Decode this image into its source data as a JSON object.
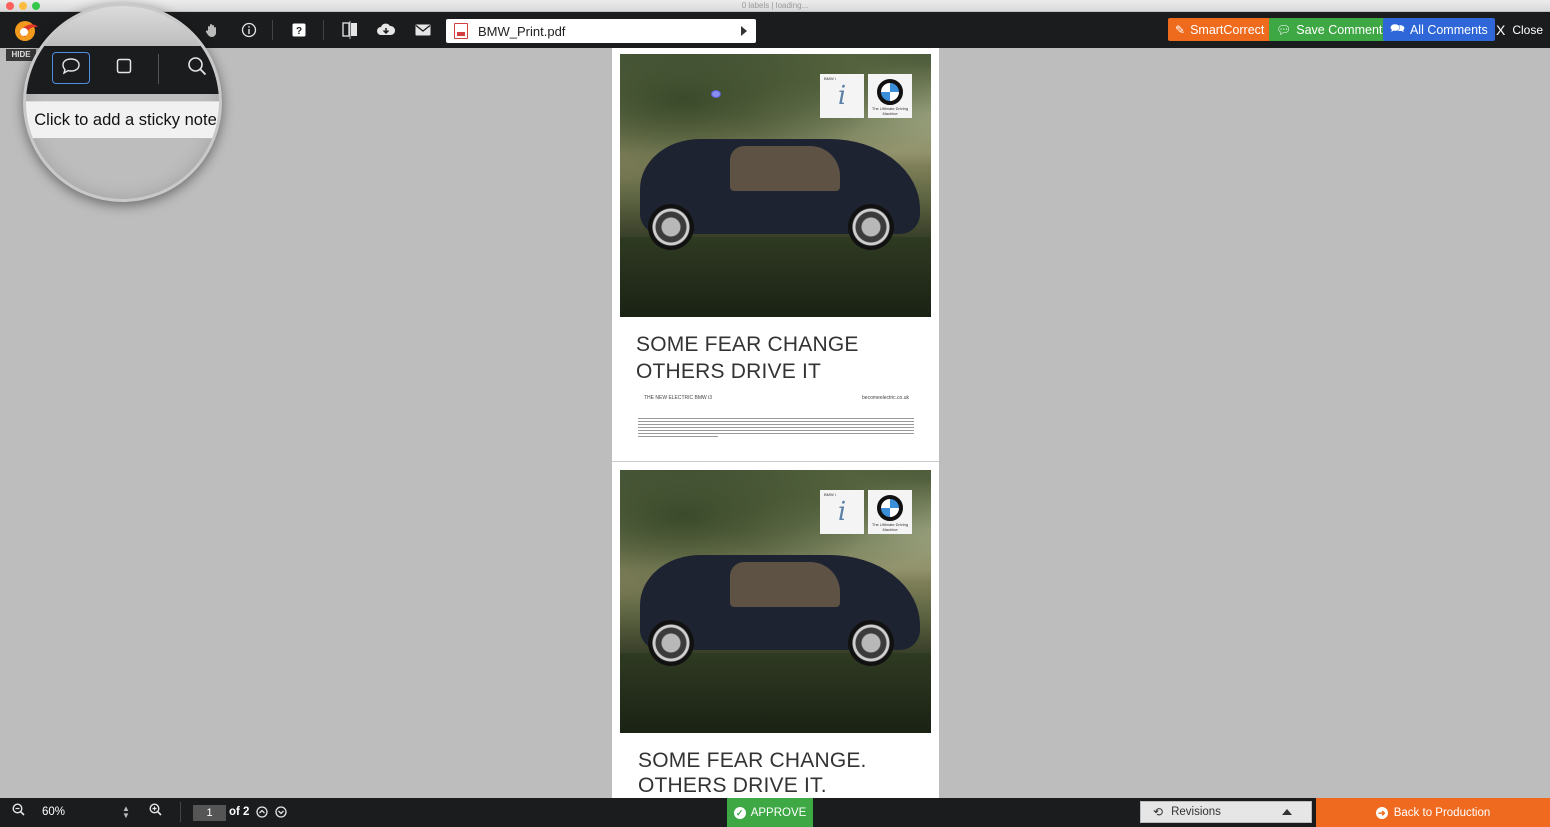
{
  "window": {
    "title": "0 labels | loading..."
  },
  "toolbar": {
    "file_name": "BMW_Print.pdf",
    "smartcorrect_label": "SmartCorrect",
    "save_comments_label": "Save Comments",
    "all_comments_label": "All Comments",
    "close_label": "Close",
    "close_glyph": "X",
    "colors": {
      "bar": "#1b1c1e",
      "smartcorrect": "#ee6b1e",
      "save_comments": "#3ea845",
      "all_comments": "#2f67d8"
    }
  },
  "left_tools": {
    "hide_label": "HIDE",
    "tooltip": "Click to add a sticky note",
    "icons": [
      "speech-bubble-icon",
      "rectangle-icon",
      "magnifier-icon"
    ]
  },
  "document": {
    "pages": [
      {
        "headline_line1": "SOME FEAR CHANGE",
        "headline_line2": "OTHERS DRIVE IT",
        "tagline": "THE NEW ELECTRIC BMW i3",
        "url": "becomeelectric.co.uk",
        "logo_i_text": "i",
        "logo_bmw_tag": "The Ultimate Driving Machine",
        "logo_bmw_small": "BMW i"
      },
      {
        "headline_line1": "SOME FEAR CHANGE.",
        "headline_line2": "OTHERS DRIVE IT.",
        "logo_i_text": "i",
        "logo_bmw_tag": "The Ultimate Driving Machine",
        "logo_bmw_small": "BMW i"
      }
    ]
  },
  "bottombar": {
    "zoom": "60%",
    "page_current": "1",
    "page_total_label": "of 2",
    "approve_label": "APPROVE",
    "revisions_label": "Revisions",
    "back_label": "Back to Production",
    "colors": {
      "approve": "#3ea845",
      "back": "#ef6a1f"
    }
  }
}
